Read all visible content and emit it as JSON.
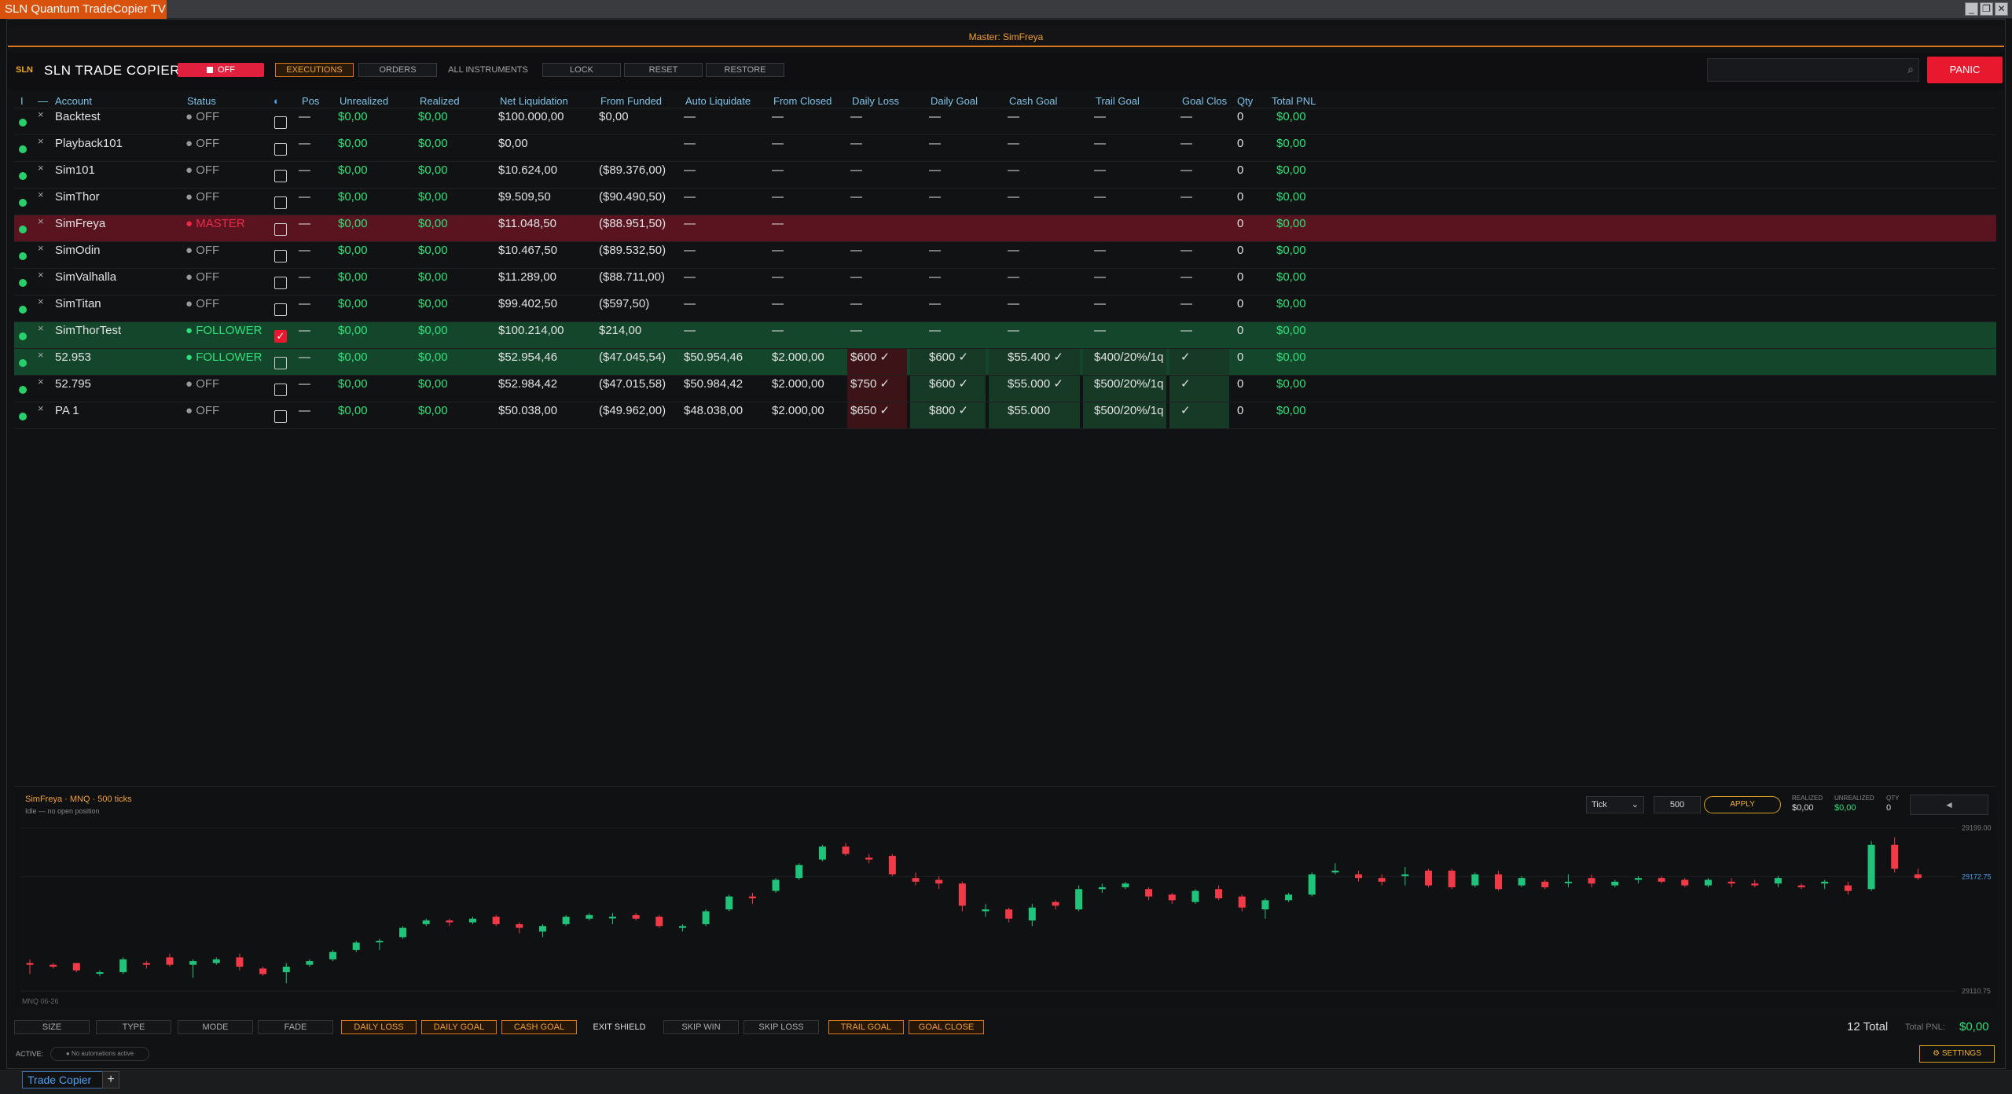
{
  "window": {
    "title": "SLN Quantum TradeCopier TV",
    "minimize": "_",
    "restore": "❐",
    "close": "✕"
  },
  "master_bar": "Master: SimFreya",
  "header": {
    "logo": "SLN",
    "title": "SLN TRADE COPIER",
    "toggle_label": "OFF",
    "tabs": [
      "EXECUTIONS",
      "ORDERS",
      "ALL INSTRUMENTS"
    ],
    "actions": [
      "LOCK",
      "RESET",
      "RESTORE"
    ],
    "search_placeholder": "",
    "search_icon": "⌕",
    "panic": "PANIC"
  },
  "table": {
    "columns": [
      "I",
      "—",
      "Account",
      "Status",
      "shield-icon",
      "Pos",
      "Unrealized",
      "Realized",
      "Net Liquidation",
      "From Funded",
      "Auto Liquidate",
      "From Closed",
      "Daily Loss",
      "Daily Goal",
      "Cash Goal",
      "Trail Goal",
      "Goal Clos",
      "Qty",
      "Total PNL"
    ],
    "rows": [
      {
        "account": "Backtest",
        "status": "● OFF",
        "pos": "—",
        "unrealized": "$0,00",
        "realized": "$0,00",
        "net_liq": "$100.000,00",
        "from_funded": "$0,00",
        "auto_liq": "—",
        "from_closed": "—",
        "daily_loss": "—",
        "daily_goal": "—",
        "cash_goal": "—",
        "trail_goal": "—",
        "goal_close": "—",
        "qty": "0",
        "total_pnl": "$0,00",
        "checked": false,
        "kind": "off"
      },
      {
        "account": "Playback101",
        "status": "● OFF",
        "pos": "—",
        "unrealized": "$0,00",
        "realized": "$0,00",
        "net_liq": "$0,00",
        "from_funded": "",
        "auto_liq": "—",
        "from_closed": "—",
        "daily_loss": "—",
        "daily_goal": "—",
        "cash_goal": "—",
        "trail_goal": "—",
        "goal_close": "—",
        "qty": "0",
        "total_pnl": "$0,00",
        "checked": false,
        "kind": "off"
      },
      {
        "account": "Sim101",
        "status": "● OFF",
        "pos": "—",
        "unrealized": "$0,00",
        "realized": "$0,00",
        "net_liq": "$10.624,00",
        "from_funded": "($89.376,00)",
        "auto_liq": "—",
        "from_closed": "—",
        "daily_loss": "—",
        "daily_goal": "—",
        "cash_goal": "—",
        "trail_goal": "—",
        "goal_close": "—",
        "qty": "0",
        "total_pnl": "$0,00",
        "checked": false,
        "kind": "off"
      },
      {
        "account": "SimThor",
        "status": "● OFF",
        "pos": "—",
        "unrealized": "$0,00",
        "realized": "$0,00",
        "net_liq": "$9.509,50",
        "from_funded": "($90.490,50)",
        "auto_liq": "—",
        "from_closed": "—",
        "daily_loss": "—",
        "daily_goal": "—",
        "cash_goal": "—",
        "trail_goal": "—",
        "goal_close": "—",
        "qty": "0",
        "total_pnl": "$0,00",
        "checked": false,
        "kind": "off"
      },
      {
        "account": "SimFreya",
        "status": "● MASTER",
        "pos": "—",
        "unrealized": "$0,00",
        "realized": "$0,00",
        "net_liq": "$11.048,50",
        "from_funded": "($88.951,50)",
        "auto_liq": "—",
        "from_closed": "—",
        "daily_loss": "",
        "daily_goal": "",
        "cash_goal": "",
        "trail_goal": "",
        "goal_close": "",
        "qty": "0",
        "total_pnl": "$0,00",
        "checked": false,
        "kind": "master"
      },
      {
        "account": "SimOdin",
        "status": "● OFF",
        "pos": "—",
        "unrealized": "$0,00",
        "realized": "$0,00",
        "net_liq": "$10.467,50",
        "from_funded": "($89.532,50)",
        "auto_liq": "—",
        "from_closed": "—",
        "daily_loss": "—",
        "daily_goal": "—",
        "cash_goal": "—",
        "trail_goal": "—",
        "goal_close": "—",
        "qty": "0",
        "total_pnl": "$0,00",
        "checked": false,
        "kind": "off"
      },
      {
        "account": "SimValhalla",
        "status": "● OFF",
        "pos": "—",
        "unrealized": "$0,00",
        "realized": "$0,00",
        "net_liq": "$11.289,00",
        "from_funded": "($88.711,00)",
        "auto_liq": "—",
        "from_closed": "—",
        "daily_loss": "—",
        "daily_goal": "—",
        "cash_goal": "—",
        "trail_goal": "—",
        "goal_close": "—",
        "qty": "0",
        "total_pnl": "$0,00",
        "checked": false,
        "kind": "off"
      },
      {
        "account": "SimTitan",
        "status": "● OFF",
        "pos": "—",
        "unrealized": "$0,00",
        "realized": "$0,00",
        "net_liq": "$99.402,50",
        "from_funded": "($597,50)",
        "auto_liq": "—",
        "from_closed": "—",
        "daily_loss": "—",
        "daily_goal": "—",
        "cash_goal": "—",
        "trail_goal": "—",
        "goal_close": "—",
        "qty": "0",
        "total_pnl": "$0,00",
        "checked": false,
        "kind": "off"
      },
      {
        "account": "SimThorTest",
        "status": "● FOLLOWER",
        "pos": "—",
        "unrealized": "$0,00",
        "realized": "$0,00",
        "net_liq": "$100.214,00",
        "from_funded": "$214,00",
        "auto_liq": "—",
        "from_closed": "—",
        "daily_loss": "—",
        "daily_goal": "—",
        "cash_goal": "—",
        "trail_goal": "—",
        "goal_close": "—",
        "qty": "0",
        "total_pnl": "$0,00",
        "checked": true,
        "kind": "follower"
      },
      {
        "account": "52.953",
        "status": "● FOLLOWER",
        "pos": "—",
        "unrealized": "$0,00",
        "realized": "$0,00",
        "net_liq": "$52.954,46",
        "from_funded": "($47.045,54)",
        "auto_liq": "$50.954,46",
        "from_closed": "$2.000,00",
        "daily_loss": "$600 ✓",
        "daily_goal": "$600 ✓",
        "cash_goal": "$55.400 ✓",
        "trail_goal": "$400/20%/1q",
        "goal_close": "✓",
        "qty": "0",
        "total_pnl": "$0,00",
        "checked": false,
        "kind": "follower"
      },
      {
        "account": "52.795",
        "status": "● OFF",
        "pos": "—",
        "unrealized": "$0,00",
        "realized": "$0,00",
        "net_liq": "$52.984,42",
        "from_funded": "($47.015,58)",
        "auto_liq": "$50.984,42",
        "from_closed": "$2.000,00",
        "daily_loss": "$750 ✓",
        "daily_goal": "$600 ✓",
        "cash_goal": "$55.000 ✓",
        "trail_goal": "$500/20%/1q",
        "goal_close": "✓",
        "qty": "0",
        "total_pnl": "$0,00",
        "checked": false,
        "kind": "goals"
      },
      {
        "account": "PA 1",
        "status": "● OFF",
        "pos": "—",
        "unrealized": "$0,00",
        "realized": "$0,00",
        "net_liq": "$50.038,00",
        "from_funded": "($49.962,00)",
        "auto_liq": "$48.038,00",
        "from_closed": "$2.000,00",
        "daily_loss": "$650 ✓",
        "daily_goal": "$800 ✓",
        "cash_goal": "$55.000",
        "trail_goal": "$500/20%/1q",
        "goal_close": "✓",
        "qty": "0",
        "total_pnl": "$0,00",
        "checked": false,
        "kind": "goals"
      }
    ]
  },
  "chart_panel": {
    "title": "SimFreya · MNQ · 500 ticks",
    "subtitle": "Idle — no open position",
    "interval_select": "Tick",
    "interval_value": "500",
    "apply": "APPLY",
    "realized_label": "REALIZED",
    "realized_value": "$0,00",
    "unrealized_label": "UNREALIZED",
    "unrealized_value": "$0,00",
    "qty_label": "QTY",
    "qty_value": "0",
    "collapse": "◄"
  },
  "chart_data": {
    "type": "candlestick",
    "instrument_label": "MNQ 06-26",
    "ytick_labels": [
      "29199.00",
      "29172.75",
      "29110.75"
    ],
    "ytick_values": [
      29199.0,
      29172.75,
      29110.75
    ],
    "ylim": [
      29104,
      29201
    ],
    "grid": true,
    "candles": [
      {
        "o": 29126,
        "h": 29128,
        "l": 29120,
        "c": 29125
      },
      {
        "o": 29125,
        "h": 29126,
        "l": 29123,
        "c": 29124
      },
      {
        "o": 29126,
        "h": 29126,
        "l": 29121,
        "c": 29122
      },
      {
        "o": 29121,
        "h": 29122,
        "l": 29119,
        "c": 29121
      },
      {
        "o": 29121,
        "h": 29129,
        "l": 29120,
        "c": 29128
      },
      {
        "o": 29126,
        "h": 29127,
        "l": 29123,
        "c": 29125
      },
      {
        "o": 29129,
        "h": 29131,
        "l": 29124,
        "c": 29125
      },
      {
        "o": 29125,
        "h": 29128,
        "l": 29118,
        "c": 29127
      },
      {
        "o": 29126,
        "h": 29129,
        "l": 29125,
        "c": 29128
      },
      {
        "o": 29129,
        "h": 29131,
        "l": 29122,
        "c": 29124
      },
      {
        "o": 29123,
        "h": 29124,
        "l": 29119,
        "c": 29120
      },
      {
        "o": 29121,
        "h": 29126,
        "l": 29115,
        "c": 29124
      },
      {
        "o": 29125,
        "h": 29128,
        "l": 29124,
        "c": 29127
      },
      {
        "o": 29128,
        "h": 29133,
        "l": 29127,
        "c": 29132
      },
      {
        "o": 29133,
        "h": 29138,
        "l": 29132,
        "c": 29137
      },
      {
        "o": 29138,
        "h": 29139,
        "l": 29133,
        "c": 29138
      },
      {
        "o": 29140,
        "h": 29146,
        "l": 29139,
        "c": 29145
      },
      {
        "o": 29147,
        "h": 29150,
        "l": 29146,
        "c": 29149
      },
      {
        "o": 29149,
        "h": 29150,
        "l": 29146,
        "c": 29148
      },
      {
        "o": 29148,
        "h": 29151,
        "l": 29147,
        "c": 29150
      },
      {
        "o": 29151,
        "h": 29152,
        "l": 29146,
        "c": 29147
      },
      {
        "o": 29147,
        "h": 29148,
        "l": 29142,
        "c": 29145
      },
      {
        "o": 29143,
        "h": 29147,
        "l": 29140,
        "c": 29146
      },
      {
        "o": 29147,
        "h": 29152,
        "l": 29146,
        "c": 29151
      },
      {
        "o": 29150,
        "h": 29153,
        "l": 29149,
        "c": 29152
      },
      {
        "o": 29151,
        "h": 29153,
        "l": 29147,
        "c": 29151
      },
      {
        "o": 29152,
        "h": 29153,
        "l": 29149,
        "c": 29150
      },
      {
        "o": 29151,
        "h": 29152,
        "l": 29145,
        "c": 29146
      },
      {
        "o": 29145,
        "h": 29147,
        "l": 29143,
        "c": 29146
      },
      {
        "o": 29147,
        "h": 29155,
        "l": 29146,
        "c": 29154
      },
      {
        "o": 29155,
        "h": 29163,
        "l": 29154,
        "c": 29162
      },
      {
        "o": 29162,
        "h": 29164,
        "l": 29158,
        "c": 29161
      },
      {
        "o": 29165,
        "h": 29172,
        "l": 29164,
        "c": 29171
      },
      {
        "o": 29172,
        "h": 29180,
        "l": 29171,
        "c": 29179
      },
      {
        "o": 29182,
        "h": 29190,
        "l": 29181,
        "c": 29189
      },
      {
        "o": 29189,
        "h": 29191,
        "l": 29184,
        "c": 29185
      },
      {
        "o": 29183,
        "h": 29185,
        "l": 29180,
        "c": 29182
      },
      {
        "o": 29184,
        "h": 29185,
        "l": 29173,
        "c": 29174
      },
      {
        "o": 29172,
        "h": 29175,
        "l": 29168,
        "c": 29170
      },
      {
        "o": 29171,
        "h": 29173,
        "l": 29166,
        "c": 29169
      },
      {
        "o": 29169,
        "h": 29170,
        "l": 29154,
        "c": 29157
      },
      {
        "o": 29154,
        "h": 29158,
        "l": 29151,
        "c": 29155
      },
      {
        "o": 29155,
        "h": 29156,
        "l": 29148,
        "c": 29150
      },
      {
        "o": 29149,
        "h": 29158,
        "l": 29146,
        "c": 29156
      },
      {
        "o": 29159,
        "h": 29160,
        "l": 29155,
        "c": 29157
      },
      {
        "o": 29155,
        "h": 29168,
        "l": 29154,
        "c": 29166
      },
      {
        "o": 29166,
        "h": 29169,
        "l": 29164,
        "c": 29167
      },
      {
        "o": 29167,
        "h": 29170,
        "l": 29166,
        "c": 29169
      },
      {
        "o": 29166,
        "h": 29167,
        "l": 29160,
        "c": 29162
      },
      {
        "o": 29163,
        "h": 29164,
        "l": 29158,
        "c": 29160
      },
      {
        "o": 29159,
        "h": 29166,
        "l": 29158,
        "c": 29165
      },
      {
        "o": 29166,
        "h": 29168,
        "l": 29160,
        "c": 29161
      },
      {
        "o": 29162,
        "h": 29163,
        "l": 29154,
        "c": 29156
      },
      {
        "o": 29155,
        "h": 29161,
        "l": 29150,
        "c": 29160
      },
      {
        "o": 29160,
        "h": 29164,
        "l": 29159,
        "c": 29163
      },
      {
        "o": 29163,
        "h": 29175,
        "l": 29162,
        "c": 29174
      },
      {
        "o": 29175,
        "h": 29180,
        "l": 29174,
        "c": 29176
      },
      {
        "o": 29174,
        "h": 29176,
        "l": 29170,
        "c": 29172
      },
      {
        "o": 29172,
        "h": 29174,
        "l": 29168,
        "c": 29170
      },
      {
        "o": 29173,
        "h": 29178,
        "l": 29168,
        "c": 29174
      },
      {
        "o": 29176,
        "h": 29177,
        "l": 29167,
        "c": 29168
      },
      {
        "o": 29176,
        "h": 29177,
        "l": 29166,
        "c": 29167
      },
      {
        "o": 29168,
        "h": 29175,
        "l": 29167,
        "c": 29174
      },
      {
        "o": 29174,
        "h": 29176,
        "l": 29165,
        "c": 29166
      },
      {
        "o": 29168,
        "h": 29173,
        "l": 29167,
        "c": 29172
      },
      {
        "o": 29170,
        "h": 29171,
        "l": 29166,
        "c": 29167
      },
      {
        "o": 29170,
        "h": 29174,
        "l": 29167,
        "c": 29170
      },
      {
        "o": 29172,
        "h": 29174,
        "l": 29167,
        "c": 29169
      },
      {
        "o": 29168,
        "h": 29171,
        "l": 29167,
        "c": 29170
      },
      {
        "o": 29171,
        "h": 29173,
        "l": 29169,
        "c": 29172
      },
      {
        "o": 29172,
        "h": 29173,
        "l": 29169,
        "c": 29170
      },
      {
        "o": 29171,
        "h": 29172,
        "l": 29167,
        "c": 29168
      },
      {
        "o": 29168,
        "h": 29172,
        "l": 29167,
        "c": 29171
      },
      {
        "o": 29170,
        "h": 29172,
        "l": 29167,
        "c": 29169
      },
      {
        "o": 29169,
        "h": 29171,
        "l": 29167,
        "c": 29168
      },
      {
        "o": 29169,
        "h": 29173,
        "l": 29167,
        "c": 29172
      },
      {
        "o": 29168,
        "h": 29169,
        "l": 29166,
        "c": 29167
      },
      {
        "o": 29169,
        "h": 29171,
        "l": 29166,
        "c": 29170
      },
      {
        "o": 29168,
        "h": 29170,
        "l": 29163,
        "c": 29165
      },
      {
        "o": 29166,
        "h": 29192,
        "l": 29165,
        "c": 29190
      },
      {
        "o": 29190,
        "h": 29194,
        "l": 29175,
        "c": 29177
      },
      {
        "o": 29174,
        "h": 29177,
        "l": 29171,
        "c": 29172
      }
    ]
  },
  "bottom_toolbar": {
    "buttons": [
      "SIZE",
      "TYPE",
      "MODE",
      "FADE",
      "DAILY LOSS",
      "DAILY GOAL",
      "CASH GOAL",
      "EXIT SHIELD",
      "SKIP WIN",
      "SKIP LOSS",
      "TRAIL GOAL",
      "GOAL CLOSE"
    ],
    "total_count": "12 Total",
    "total_pnl_label": "Total PNL:",
    "total_pnl": "$0,00"
  },
  "status_bar": {
    "active_label": "ACTIVE:",
    "active_chip": "● No automations active",
    "settings": "⚙ SETTINGS"
  },
  "tabs": {
    "main": "Trade Copier",
    "add": "+"
  },
  "colors": {
    "accent": "#d8781e",
    "green": "#2fe07a",
    "red": "#f0294a",
    "master_row": "#5a1420",
    "follower_row": "#14462c",
    "candle_up": "#1fc47a",
    "candle_down": "#f03a48"
  }
}
